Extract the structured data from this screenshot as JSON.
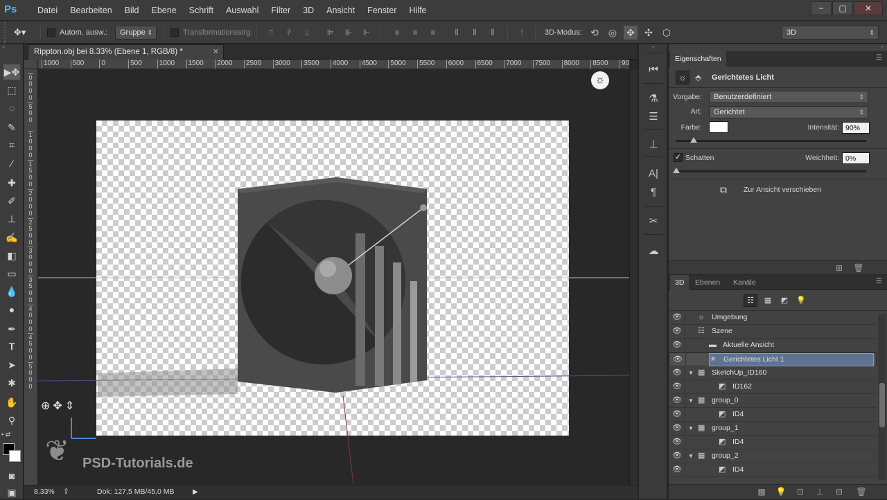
{
  "app": {
    "logo": "Ps"
  },
  "menubar": {
    "items": [
      "Datei",
      "Bearbeiten",
      "Bild",
      "Ebene",
      "Schrift",
      "Auswahl",
      "Filter",
      "3D",
      "Ansicht",
      "Fenster",
      "Hilfe"
    ],
    "window_controls": {
      "minimize": "−",
      "maximize": "▢",
      "close": "✕"
    }
  },
  "options": {
    "auto_select_label": "Autom. ausw.:",
    "auto_select_value": "Gruppe",
    "transform_label": "Transformationsstrg.",
    "mode_label": "3D-Modus:",
    "workspace_value": "3D"
  },
  "document": {
    "tab_title": "Rippton.obj bei 8.33% (Ebene 1, RGB/8) *",
    "tab_close": "✕",
    "zoom": "8.33%",
    "doc_size": "Dok: 127,5 MB/45,0 MB",
    "watermark": "PSD-Tutorials.de"
  },
  "ruler": {
    "h_labels": [
      "1000",
      "500",
      "0",
      "500",
      "1000",
      "1500",
      "2000",
      "2500",
      "3000",
      "3500",
      "4000",
      "4500",
      "5000",
      "5500",
      "6000",
      "6500",
      "7000",
      "7500",
      "8000",
      "8500",
      "90"
    ],
    "v_groups": [
      [
        "0",
        "0",
        "0",
        "0"
      ],
      [
        "5",
        "0",
        "0"
      ],
      [
        "1",
        "0",
        "0",
        "0"
      ],
      [
        "1",
        "5",
        "0",
        "0"
      ],
      [
        "2",
        "0",
        "0",
        "0"
      ],
      [
        "2",
        "5",
        "0",
        "0"
      ],
      [
        "3",
        "0",
        "0",
        "0"
      ],
      [
        "3",
        "5",
        "0",
        "0"
      ],
      [
        "4",
        "0",
        "0",
        "0"
      ],
      [
        "4",
        "5",
        "0",
        "0"
      ],
      [
        "5",
        "0",
        "0",
        "0"
      ]
    ]
  },
  "properties": {
    "tab": "Eigenschaften",
    "header_title": "Gerichtetes Licht",
    "preset_label": "Vorgabe:",
    "preset_value": "Benutzerdefiniert",
    "type_label": "Art:",
    "type_value": "Gerichtet",
    "color_label": "Farbe:",
    "light_color": "#ffffff",
    "intensity_label": "Intensität:",
    "intensity_value": "90%",
    "intensity": 0.09,
    "shadow_label": "Schatten",
    "shadow_checked": true,
    "softness_label": "Weichheit:",
    "softness_value": "0%",
    "softness": 0.0,
    "move_to_view": "Zur Ansicht verschieben"
  },
  "layers_panel": {
    "tabs": [
      "3D",
      "Ebenen",
      "Kanäle"
    ],
    "active_tab": "3D",
    "rows": [
      {
        "name": "Umgebung",
        "indent": 0,
        "twisty": "",
        "icon": "environment-icon",
        "glyph": "☼",
        "selected": false
      },
      {
        "name": "Szene",
        "indent": 0,
        "twisty": "",
        "icon": "scene-icon",
        "glyph": "☷",
        "selected": false
      },
      {
        "name": "Aktuelle Ansicht",
        "indent": 1,
        "twisty": "",
        "icon": "camera-icon",
        "glyph": "▬",
        "selected": false
      },
      {
        "name": "Gerichtetes Licht 1",
        "indent": 1,
        "twisty": "",
        "icon": "light-icon",
        "glyph": "☀",
        "selected": true
      },
      {
        "name": "SketchUp_ID160",
        "indent": 0,
        "twisty": "▼",
        "icon": "mesh-icon",
        "glyph": "▦",
        "selected": false
      },
      {
        "name": "ID162",
        "indent": 2,
        "twisty": "",
        "icon": "material-icon",
        "glyph": "◩",
        "selected": false
      },
      {
        "name": "group_0",
        "indent": 0,
        "twisty": "▼",
        "icon": "mesh-icon",
        "glyph": "▦",
        "selected": false
      },
      {
        "name": "ID4",
        "indent": 2,
        "twisty": "",
        "icon": "material-icon",
        "glyph": "◩",
        "selected": false
      },
      {
        "name": "group_1",
        "indent": 0,
        "twisty": "▼",
        "icon": "mesh-icon",
        "glyph": "▦",
        "selected": false
      },
      {
        "name": "ID4",
        "indent": 2,
        "twisty": "",
        "icon": "material-icon",
        "glyph": "◩",
        "selected": false
      },
      {
        "name": "group_2",
        "indent": 0,
        "twisty": "▼",
        "icon": "mesh-icon",
        "glyph": "▦",
        "selected": false
      },
      {
        "name": "ID4",
        "indent": 2,
        "twisty": "",
        "icon": "material-icon",
        "glyph": "◩",
        "selected": false
      }
    ]
  },
  "colors": {
    "accent": "#5f7290",
    "ps_blue": "#5fb3e8"
  }
}
